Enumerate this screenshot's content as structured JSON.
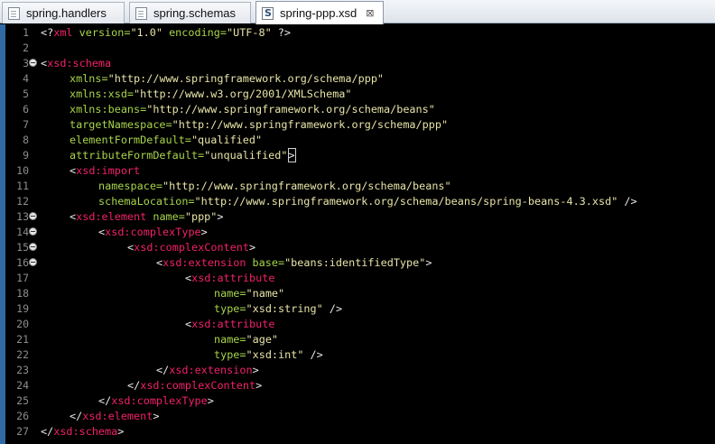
{
  "tabs": [
    {
      "label": "spring.handlers",
      "icon": "file-icon",
      "active": false
    },
    {
      "label": "spring.schemas",
      "icon": "file-icon",
      "active": false
    },
    {
      "label": "spring-ppp.xsd",
      "icon": "xsd-file-icon",
      "icon_glyph": "S",
      "active": true,
      "close_glyph": "⊠"
    }
  ],
  "lines": [
    {
      "n": "1",
      "t": [
        [
          "br",
          "<?"
        ],
        [
          "tag",
          "xml"
        ],
        [
          "pi",
          " version="
        ],
        [
          "val",
          "\"1.0\""
        ],
        [
          "pi",
          " encoding="
        ],
        [
          "val",
          "\"UTF-8\""
        ],
        [
          "br",
          " ?>"
        ]
      ]
    },
    {
      "n": "2",
      "t": []
    },
    {
      "n": "3",
      "fold": true,
      "t": [
        [
          "br",
          "<"
        ],
        [
          "tag",
          "xsd:schema"
        ]
      ]
    },
    {
      "n": "4",
      "i": 1,
      "t": [
        [
          "attr",
          "xmlns="
        ],
        [
          "val",
          "\"http://www.springframework.org/schema/ppp\""
        ]
      ]
    },
    {
      "n": "5",
      "i": 1,
      "t": [
        [
          "attr",
          "xmlns:xsd="
        ],
        [
          "val",
          "\"http://www.w3.org/2001/XMLSchema\""
        ]
      ]
    },
    {
      "n": "6",
      "i": 1,
      "t": [
        [
          "attr",
          "xmlns:beans="
        ],
        [
          "val",
          "\"http://www.springframework.org/schema/beans\""
        ]
      ]
    },
    {
      "n": "7",
      "i": 1,
      "t": [
        [
          "attr",
          "targetNamespace="
        ],
        [
          "val",
          "\"http://www.springframework.org/schema/ppp\""
        ]
      ]
    },
    {
      "n": "8",
      "i": 1,
      "t": [
        [
          "attr",
          "elementFormDefault="
        ],
        [
          "val",
          "\"qualified\""
        ]
      ]
    },
    {
      "n": "9",
      "i": 1,
      "t": [
        [
          "attr",
          "attributeFormDefault="
        ],
        [
          "val",
          "\"unqualified\""
        ],
        [
          "caret",
          ">"
        ]
      ]
    },
    {
      "n": "10",
      "i": 1,
      "t": [
        [
          "br",
          "<"
        ],
        [
          "tag",
          "xsd:import"
        ]
      ]
    },
    {
      "n": "11",
      "i": 2,
      "t": [
        [
          "attr",
          "namespace="
        ],
        [
          "val",
          "\"http://www.springframework.org/schema/beans\""
        ]
      ]
    },
    {
      "n": "12",
      "i": 2,
      "t": [
        [
          "attr",
          "schemaLocation="
        ],
        [
          "val",
          "\"http://www.springframework.org/schema/beans/spring-beans-4.3.xsd\""
        ],
        [
          "br",
          " />"
        ]
      ]
    },
    {
      "n": "13",
      "i": 1,
      "fold": true,
      "t": [
        [
          "br",
          "<"
        ],
        [
          "tag",
          "xsd:element"
        ],
        [
          "attr",
          " name="
        ],
        [
          "val",
          "\"ppp\""
        ],
        [
          "br",
          ">"
        ]
      ]
    },
    {
      "n": "14",
      "i": 2,
      "fold": true,
      "t": [
        [
          "br",
          "<"
        ],
        [
          "tag",
          "xsd:complexType"
        ],
        [
          "br",
          ">"
        ]
      ]
    },
    {
      "n": "15",
      "i": 3,
      "fold": true,
      "t": [
        [
          "br",
          "<"
        ],
        [
          "tag",
          "xsd:complexContent"
        ],
        [
          "br",
          ">"
        ]
      ]
    },
    {
      "n": "16",
      "i": 4,
      "fold": true,
      "t": [
        [
          "br",
          "<"
        ],
        [
          "tag",
          "xsd:extension"
        ],
        [
          "attr",
          " base="
        ],
        [
          "val",
          "\"beans:identifiedType\""
        ],
        [
          "br",
          ">"
        ]
      ]
    },
    {
      "n": "17",
      "i": 5,
      "t": [
        [
          "br",
          "<"
        ],
        [
          "tag",
          "xsd:attribute"
        ]
      ]
    },
    {
      "n": "18",
      "i": 6,
      "t": [
        [
          "attr",
          "name="
        ],
        [
          "val",
          "\"name\""
        ]
      ]
    },
    {
      "n": "19",
      "i": 6,
      "t": [
        [
          "attr",
          "type="
        ],
        [
          "val",
          "\"xsd:string\""
        ],
        [
          "br",
          " />"
        ]
      ]
    },
    {
      "n": "20",
      "i": 5,
      "t": [
        [
          "br",
          "<"
        ],
        [
          "tag",
          "xsd:attribute"
        ]
      ]
    },
    {
      "n": "21",
      "i": 6,
      "t": [
        [
          "attr",
          "name="
        ],
        [
          "val",
          "\"age\""
        ]
      ]
    },
    {
      "n": "22",
      "i": 6,
      "t": [
        [
          "attr",
          "type="
        ],
        [
          "val",
          "\"xsd:int\""
        ],
        [
          "br",
          " />"
        ]
      ]
    },
    {
      "n": "23",
      "i": 4,
      "t": [
        [
          "br",
          "</"
        ],
        [
          "tag",
          "xsd:extension"
        ],
        [
          "br",
          ">"
        ]
      ]
    },
    {
      "n": "24",
      "i": 3,
      "t": [
        [
          "br",
          "</"
        ],
        [
          "tag",
          "xsd:complexContent"
        ],
        [
          "br",
          ">"
        ]
      ]
    },
    {
      "n": "25",
      "i": 2,
      "t": [
        [
          "br",
          "</"
        ],
        [
          "tag",
          "xsd:complexType"
        ],
        [
          "br",
          ">"
        ]
      ]
    },
    {
      "n": "26",
      "i": 1,
      "t": [
        [
          "br",
          "</"
        ],
        [
          "tag",
          "xsd:element"
        ],
        [
          "br",
          ">"
        ]
      ]
    },
    {
      "n": "27",
      "t": [
        [
          "br",
          "</"
        ],
        [
          "tag",
          "xsd:schema"
        ],
        [
          "br",
          ">"
        ]
      ]
    }
  ],
  "colors": {
    "background": "#000000",
    "tag": "#f2206b",
    "attribute": "#a8d44a",
    "value": "#e8e4a8",
    "line_number": "#8d8d8d"
  }
}
